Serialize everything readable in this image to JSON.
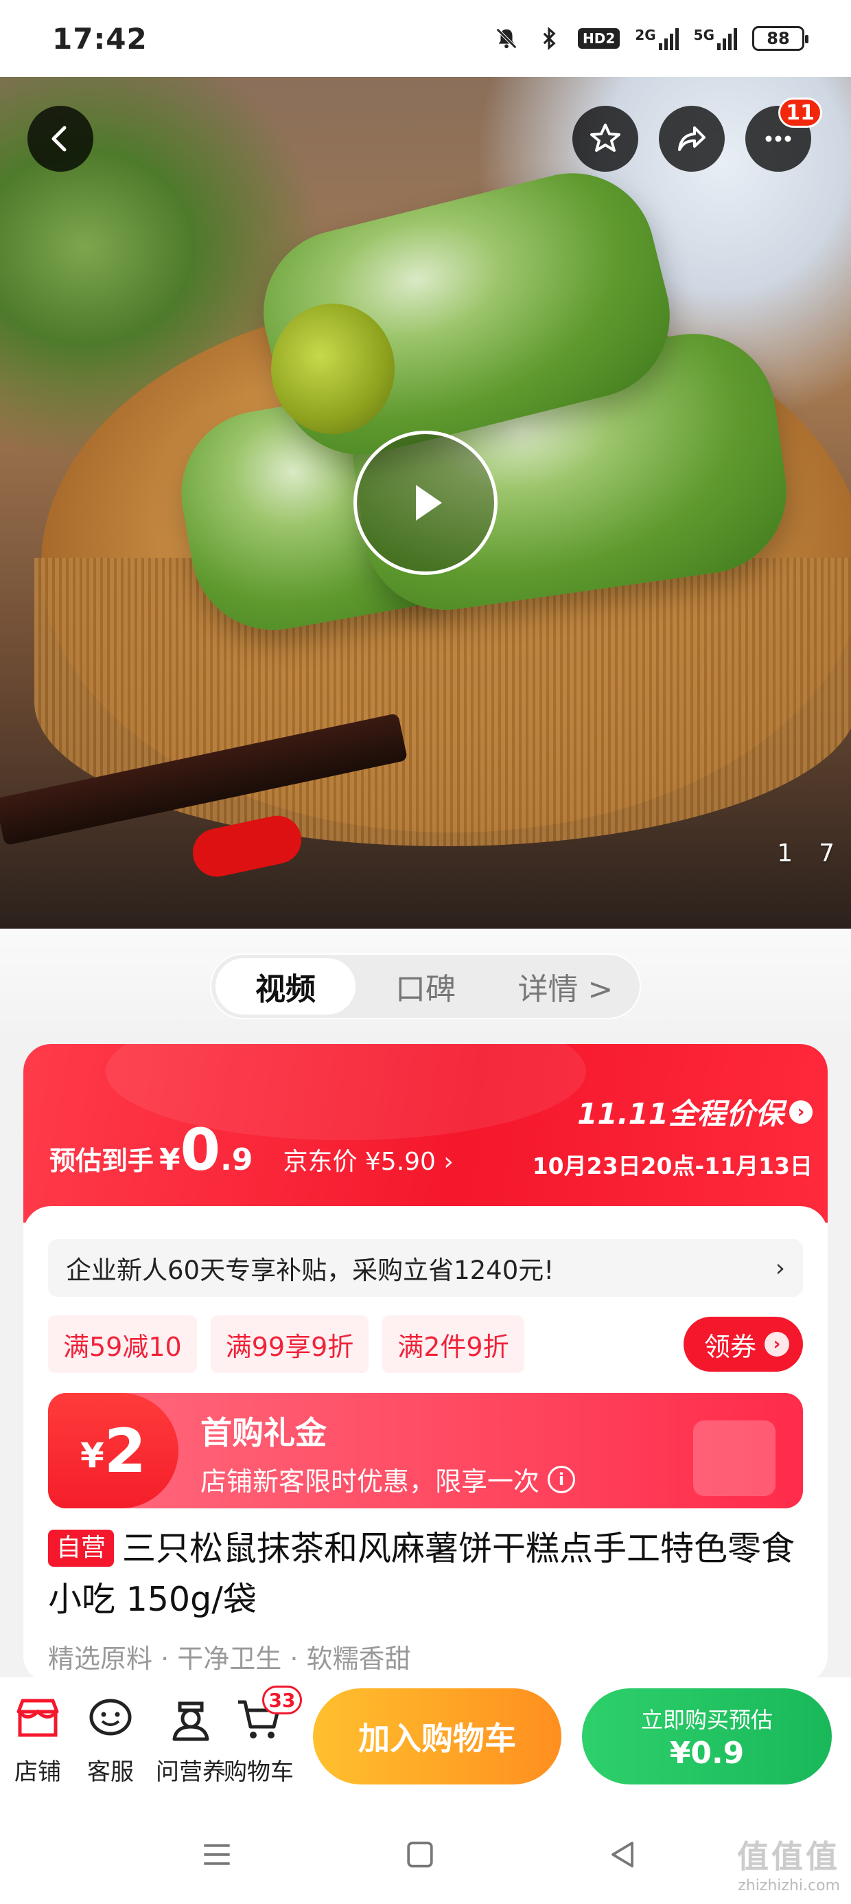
{
  "status_bar": {
    "time": "17:42",
    "hd_label": "HD2",
    "net1_label": "2G",
    "net2_label": "5G",
    "battery": "88",
    "icons": [
      "mute-bell-icon",
      "bluetooth-icon",
      "hd-icon",
      "signal-icon",
      "signal-icon",
      "battery-icon"
    ]
  },
  "hero": {
    "badge_count": "11",
    "page_current": "1",
    "page_total": "7",
    "icons": [
      "back-icon",
      "star-icon",
      "share-icon",
      "more-icon",
      "play-icon"
    ]
  },
  "tabs": [
    {
      "label": "视频",
      "active": true
    },
    {
      "label": "口碑",
      "active": false
    },
    {
      "label": "详情 >",
      "active": false
    }
  ],
  "price": {
    "label": "预估到手",
    "yen": "¥",
    "integer": "0",
    "decimal": ".9",
    "jd_price": "京东价 ¥5.90 ›",
    "promo_title": "11.11全程价保",
    "promo_arrow": "›",
    "promo_date": "10月23日20点-11月13日"
  },
  "subsidy": {
    "text": "企业新人60天专享补贴，采购立省1240元!",
    "arrow": "›"
  },
  "coupons": [
    "满59减10",
    "满99享9折",
    "满2件9折"
  ],
  "get_coupon": {
    "label": "领券",
    "arrow": "›"
  },
  "gift": {
    "yen": "¥",
    "amount": "2",
    "title": "首购礼金",
    "desc": "店铺新客限时优惠，限享一次",
    "info": "i"
  },
  "product": {
    "tag": "自营",
    "title": "三只松鼠抹茶和风麻薯饼干糕点手工特色零食小吃 150g/袋",
    "subtitle": "精选原料 · 干净卫生 · 软糯香甜"
  },
  "bottom_bar": {
    "items": [
      {
        "label": "店铺",
        "icon": "store-icon"
      },
      {
        "label": "客服",
        "icon": "chat-icon"
      },
      {
        "label": "问营养",
        "icon": "nutritionist-icon"
      },
      {
        "label": "购物车",
        "icon": "cart-icon"
      }
    ],
    "cart_count": "33",
    "add_cart": "加入购物车",
    "buy_line1": "立即购买预估",
    "buy_line2": "¥0.9"
  },
  "watermark": {
    "line1": "值值值",
    "line2": "zhizhizhi.com"
  },
  "colors": {
    "accent_red": "#f5172c",
    "cart_orange": "#ff9a1f",
    "buy_green": "#19b85a"
  }
}
